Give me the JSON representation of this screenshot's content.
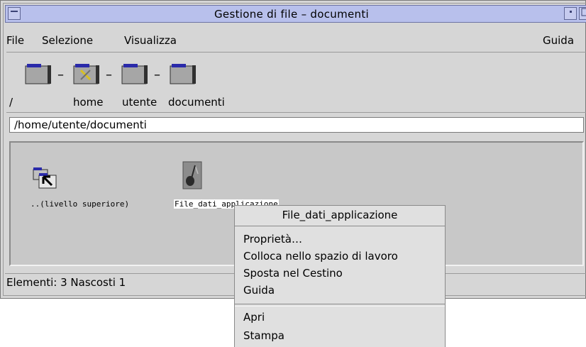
{
  "window": {
    "title": "Gestione di file – documenti"
  },
  "menubar": {
    "file": {
      "label": "File"
    },
    "selezione": {
      "label": "Selezione"
    },
    "visualizza": {
      "label": "Visualizza"
    },
    "guida": {
      "label": "Guida"
    }
  },
  "path_bar": {
    "items": [
      {
        "label": "/"
      },
      {
        "label": "home"
      },
      {
        "label": "utente"
      },
      {
        "label": "documenti"
      }
    ],
    "current_path": "/home/utente/documenti"
  },
  "files": [
    {
      "label": "..(livello superiore)",
      "icon": "up-folder-icon"
    },
    {
      "label": "File_dati_applicazione",
      "icon": "data-file-icon"
    }
  ],
  "status": "Elementi: 3 Nascosti 1",
  "context_menu": {
    "title": "File_dati_applicazione",
    "items": [
      {
        "label": "Proprietà…"
      },
      {
        "label": "Colloca nello spazio di lavoro"
      },
      {
        "label": "Sposta nel Cestino"
      },
      {
        "label": "Guida"
      },
      {
        "label": "Apri"
      },
      {
        "label": "Stampa"
      }
    ]
  },
  "colors": {
    "titlebar": "#b8c0ec",
    "window": "#d6d6d6",
    "content": "#c8c8c8",
    "menu": "#e0e0e0"
  }
}
